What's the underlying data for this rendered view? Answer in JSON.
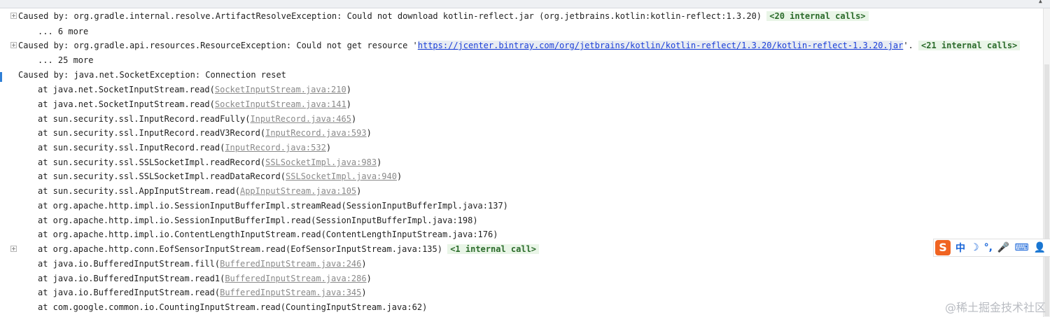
{
  "console": {
    "lines": [
      {
        "type": "caused",
        "fold": true,
        "text": "Caused by: org.gradle.internal.resolve.ArtifactResolveException: Could not download kotlin-reflect.jar (org.jetbrains.kotlin:kotlin-reflect:1.3.20)",
        "internal": "<20 internal calls>"
      },
      {
        "type": "more",
        "text": "... 6 more"
      },
      {
        "type": "caused-link",
        "fold": true,
        "before": "Caused by: org.gradle.api.resources.ResourceException: Could not get resource '",
        "link": "https://jcenter.bintray.com/org/jetbrains/kotlin/kotlin-reflect/1.3.20/kotlin-reflect-1.3.20.jar",
        "after": "'.",
        "internal": "<21 internal calls>"
      },
      {
        "type": "more",
        "text": "... 25 more"
      },
      {
        "type": "caused",
        "text": "Caused by: java.net.SocketException: Connection reset"
      },
      {
        "type": "frame",
        "method": "at java.net.SocketInputStream.read(",
        "source": "SocketInputStream.java:210",
        "close": ")"
      },
      {
        "type": "frame",
        "method": "at java.net.SocketInputStream.read(",
        "source": "SocketInputStream.java:141",
        "close": ")"
      },
      {
        "type": "frame",
        "method": "at sun.security.ssl.InputRecord.readFully(",
        "source": "InputRecord.java:465",
        "close": ")"
      },
      {
        "type": "frame",
        "method": "at sun.security.ssl.InputRecord.readV3Record(",
        "source": "InputRecord.java:593",
        "close": ")"
      },
      {
        "type": "frame",
        "method": "at sun.security.ssl.InputRecord.read(",
        "source": "InputRecord.java:532",
        "close": ")"
      },
      {
        "type": "frame",
        "method": "at sun.security.ssl.SSLSocketImpl.readRecord(",
        "source": "SSLSocketImpl.java:983",
        "close": ")"
      },
      {
        "type": "frame",
        "method": "at sun.security.ssl.SSLSocketImpl.readDataRecord(",
        "source": "SSLSocketImpl.java:940",
        "close": ")"
      },
      {
        "type": "frame",
        "method": "at sun.security.ssl.AppInputStream.read(",
        "source": "AppInputStream.java:105",
        "close": ")"
      },
      {
        "type": "plain",
        "text": "at org.apache.http.impl.io.SessionInputBufferImpl.streamRead(SessionInputBufferImpl.java:137)"
      },
      {
        "type": "plain",
        "text": "at org.apache.http.impl.io.SessionInputBufferImpl.read(SessionInputBufferImpl.java:198)"
      },
      {
        "type": "plain",
        "text": "at org.apache.http.impl.io.ContentLengthInputStream.read(ContentLengthInputStream.java:176)"
      },
      {
        "type": "plain",
        "fold": true,
        "text": "at org.apache.http.conn.EofSensorInputStream.read(EofSensorInputStream.java:135)",
        "internal": "<1 internal call>"
      },
      {
        "type": "frame",
        "method": "at java.io.BufferedInputStream.fill(",
        "source": "BufferedInputStream.java:246",
        "close": ")"
      },
      {
        "type": "frame",
        "method": "at java.io.BufferedInputStream.read1(",
        "source": "BufferedInputStream.java:286",
        "close": ")"
      },
      {
        "type": "frame",
        "method": "at java.io.BufferedInputStream.read(",
        "source": "BufferedInputStream.java:345",
        "close": ")"
      },
      {
        "type": "plain",
        "text": "at com.google.common.io.CountingInputStream.read(CountingInputStream.java:62)"
      }
    ]
  },
  "ime_toolbar": {
    "logo": "S",
    "items": [
      {
        "icon": "chinese-mode-icon",
        "glyph": "中"
      },
      {
        "icon": "moon-icon",
        "glyph": "☽"
      },
      {
        "icon": "punctuation-icon",
        "glyph": "°,"
      },
      {
        "icon": "microphone-icon",
        "glyph": "🎤"
      },
      {
        "icon": "keyboard-icon",
        "glyph": "⌨"
      },
      {
        "icon": "user-icon",
        "glyph": "👤"
      }
    ]
  },
  "watermark": "@稀土掘金技术社区",
  "colors": {
    "link": "#1a3ed8",
    "internal_bg": "#e9f5e7",
    "source_link": "#8a8a8a",
    "ime_brand": "#f06422"
  }
}
